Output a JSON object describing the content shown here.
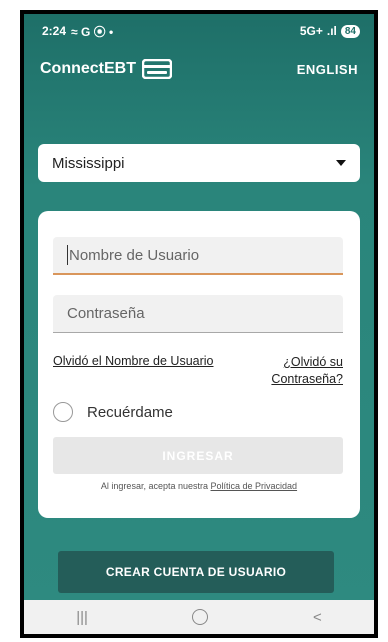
{
  "status_bar": {
    "time": "2:24",
    "left_indicators": "≈ G ⦿ •",
    "network": "5G+",
    "signal": ".ıl",
    "battery": "84"
  },
  "header": {
    "brand": "ConnectEBT",
    "language_button": "ENGLISH"
  },
  "state_select": {
    "value": "Mississippi"
  },
  "login_form": {
    "username_placeholder": "Nombre de Usuario",
    "password_placeholder": "Contraseña",
    "forgot_username": "Olvidó el Nombre de Usuario",
    "forgot_password_line1": "¿Olvidó su",
    "forgot_password_line2": "Contraseña?",
    "remember_me": "Recuérdame",
    "login_button": "INGRESAR",
    "privacy_prefix": "Al ingresar, acepta nuestra",
    "privacy_link": "Política de Privacidad"
  },
  "create_account_button": "CREAR CUENTA DE USUARIO",
  "nav": {
    "recents": "|||",
    "back": "<"
  },
  "colors": {
    "teal_dark": "#1e6f68",
    "teal": "#2e8a80",
    "button_dark": "#245d59",
    "focus_underline": "#d9965b"
  }
}
